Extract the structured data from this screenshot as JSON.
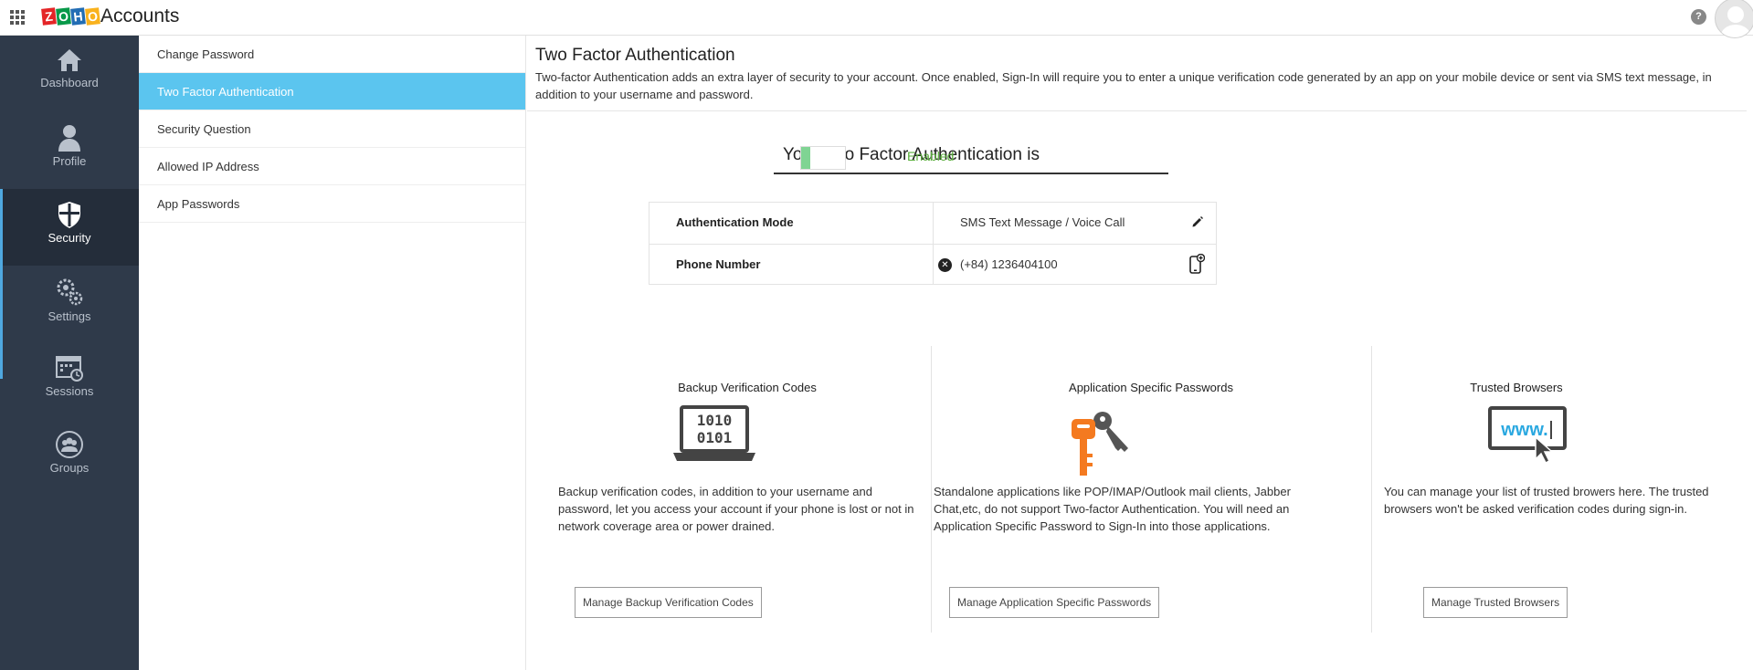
{
  "header": {
    "logo_letters": [
      "Z",
      "O",
      "H",
      "O"
    ],
    "logo_colors": [
      "#e42527",
      "#089949",
      "#226db4",
      "#f9b21d"
    ],
    "app_title": "Accounts",
    "help_glyph": "?"
  },
  "leftnav": {
    "items": [
      {
        "label": "Dashboard",
        "icon": "home-icon"
      },
      {
        "label": "Profile",
        "icon": "person-icon"
      },
      {
        "label": "Security",
        "icon": "shield-icon",
        "active": true
      },
      {
        "label": "Settings",
        "icon": "gears-icon"
      },
      {
        "label": "Sessions",
        "icon": "calendar-clock-icon"
      },
      {
        "label": "Groups",
        "icon": "group-icon"
      }
    ]
  },
  "submenu": {
    "items": [
      {
        "label": "Change Password"
      },
      {
        "label": "Two Factor Authentication",
        "active": true
      },
      {
        "label": "Security Question"
      },
      {
        "label": "Allowed IP Address"
      },
      {
        "label": "App Passwords"
      }
    ]
  },
  "main": {
    "title": "Two Factor Authentication",
    "description": "Two-factor Authentication adds an extra layer of security to your account. Once enabled, Sign-In will require you to enter a unique verification code generated by an app on your mobile device or sent via SMS text message, in addition to your username and password.",
    "status_text": "Your Two Factor Authentication is",
    "status_value": "Enabled",
    "auth": {
      "mode_label": "Authentication Mode",
      "mode_value": "SMS Text Message / Voice Call",
      "phone_label": "Phone Number",
      "phone_value": "(+84) 1236404100"
    },
    "features": [
      {
        "title": "Backup Verification Codes",
        "icon": "laptop-binary-icon",
        "icon_text_1": "1010",
        "icon_text_2": "0101",
        "description": "Backup verification codes, in addition to your username and password, let you access your account if your phone is lost or not in network coverage area or power drained.",
        "button": "Manage Backup Verification Codes"
      },
      {
        "title": "Application Specific Passwords",
        "icon": "keys-icon",
        "description": "Standalone applications like POP/IMAP/Outlook mail clients, Jabber Chat,etc, do not support Two-factor Authentication. You will need an Application Specific Password to Sign-In into those applications.",
        "button": "Manage Application Specific Passwords"
      },
      {
        "title": "Trusted Browsers",
        "icon": "browser-www-icon",
        "icon_text": "www.",
        "description": "You can manage your list of trusted browers here. The trusted browsers won't be asked verification codes during sign-in.",
        "button": "Manage Trusted Browsers"
      }
    ]
  },
  "colors": {
    "nav_bg": "#2f3a4a",
    "submenu_active": "#5bc5ef",
    "enabled_green": "#5aae3c",
    "key_orange": "#f47a20",
    "www_blue": "#2aa8e0"
  }
}
